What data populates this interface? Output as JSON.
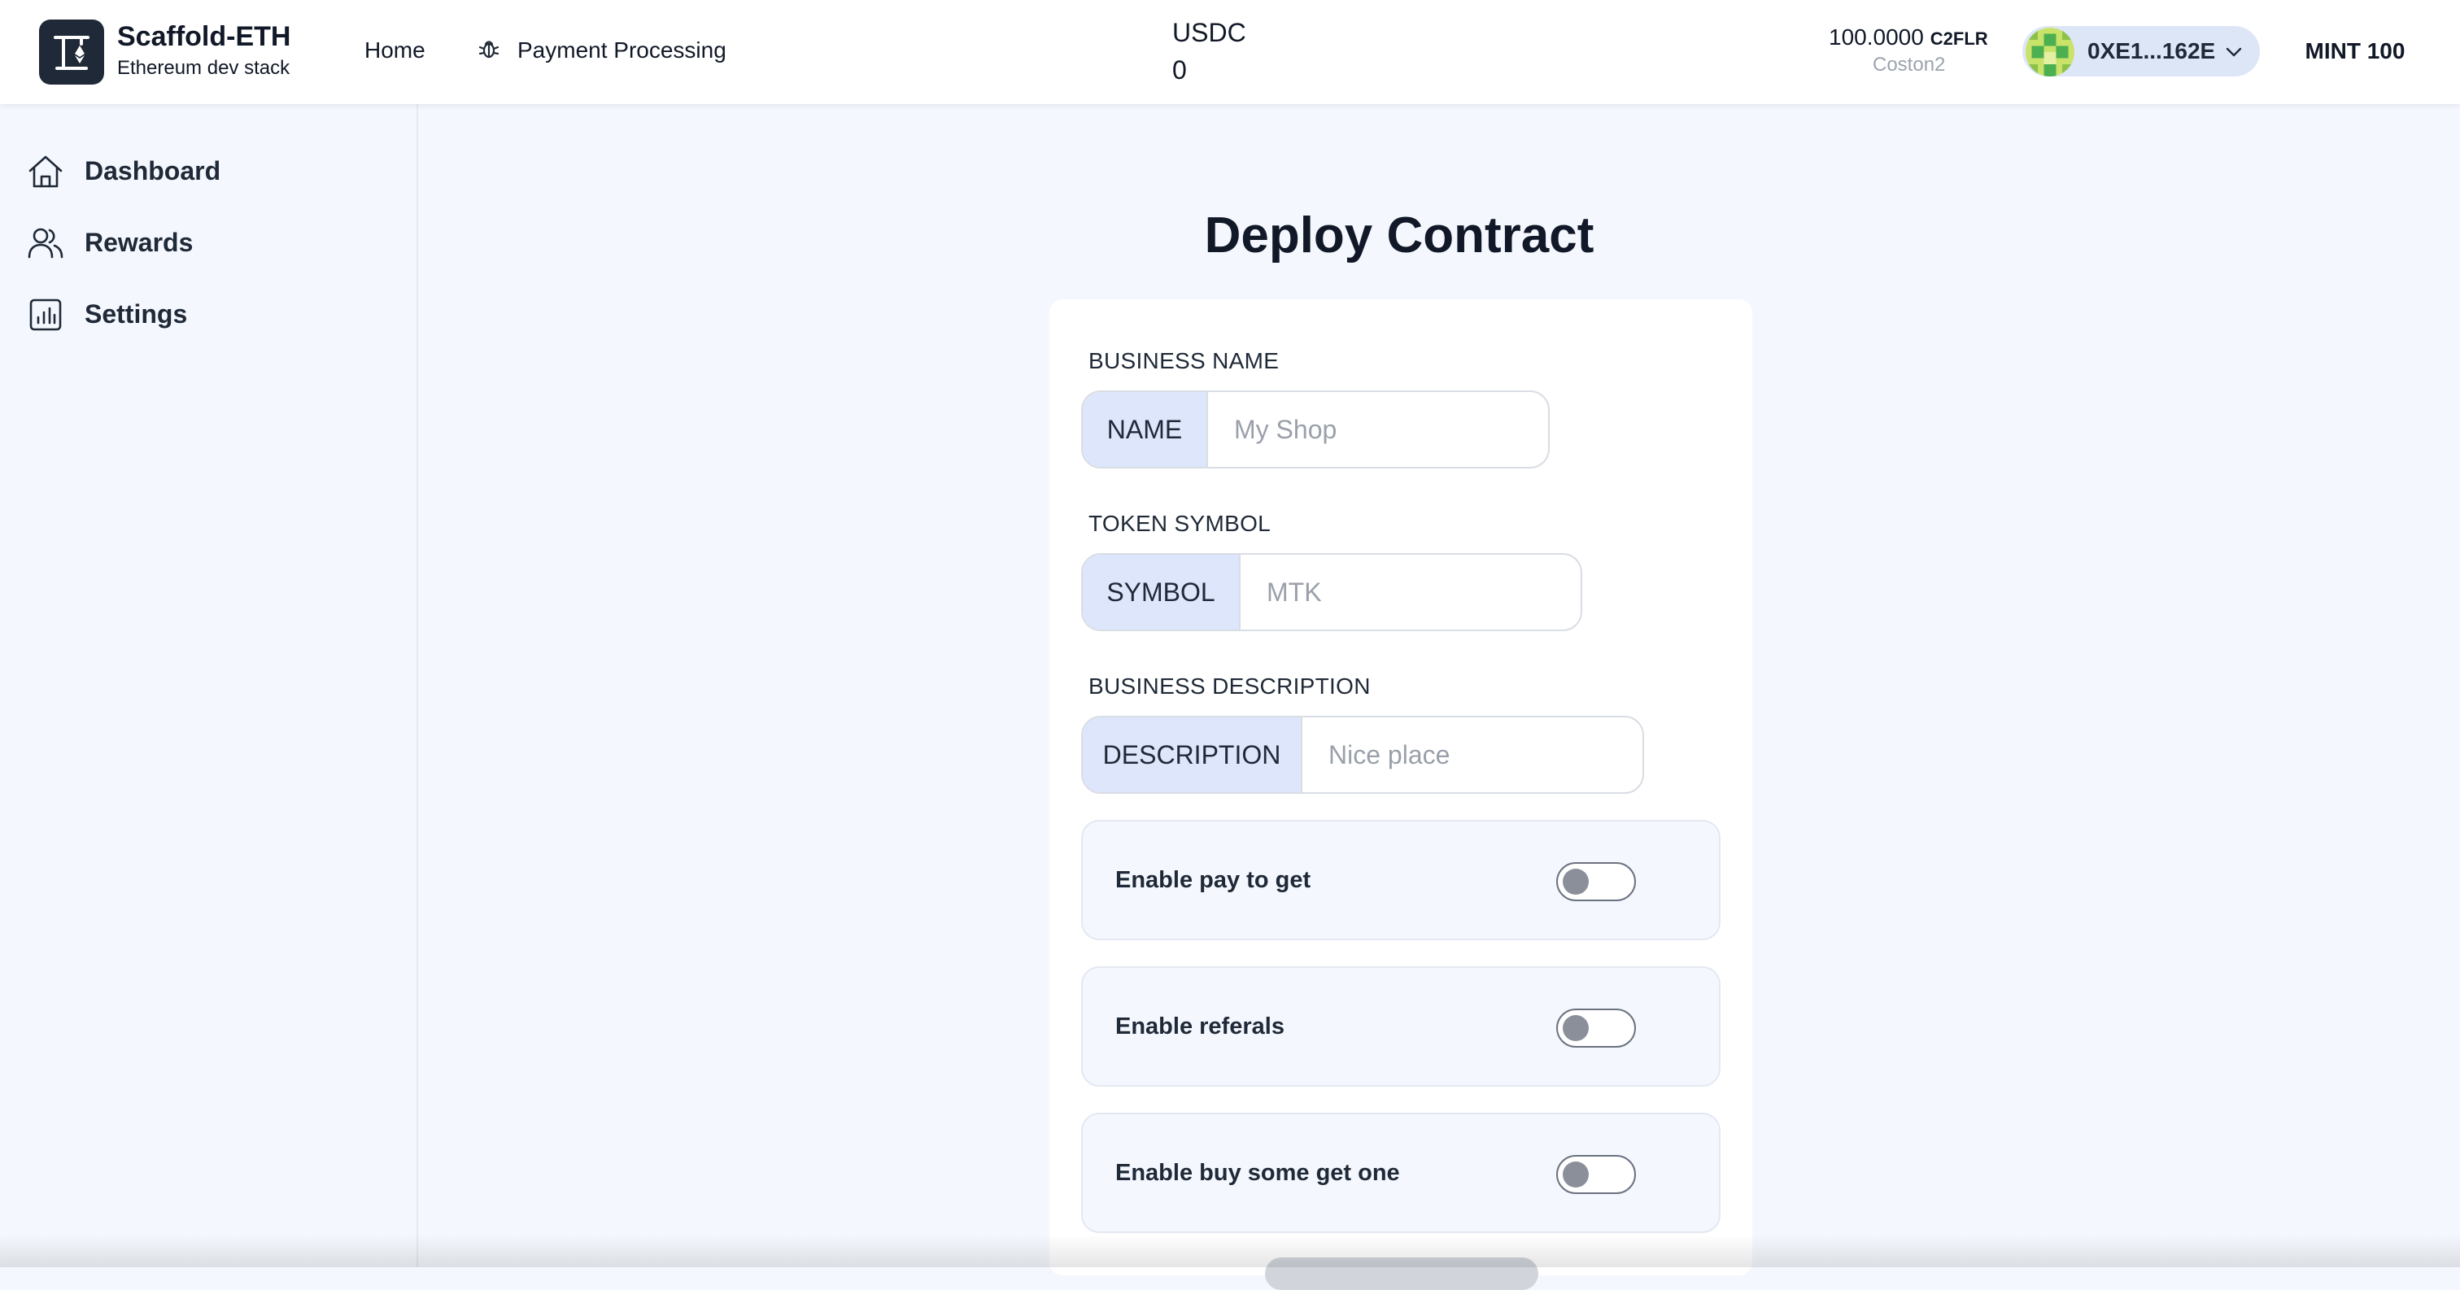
{
  "header": {
    "brand_title": "Scaffold-ETH",
    "brand_subtitle": "Ethereum dev stack",
    "nav": {
      "home": "Home",
      "payment_processing": "Payment Processing"
    },
    "token": {
      "label": "USDC",
      "value": "0"
    },
    "balance": {
      "amount": "100.0000",
      "symbol": "C2FLR",
      "network": "Coston2"
    },
    "account": {
      "address": "0XE1...162E"
    },
    "mint_button": "MINT 100"
  },
  "sidebar": {
    "items": [
      {
        "label": "Dashboard",
        "icon": "home-icon"
      },
      {
        "label": "Rewards",
        "icon": "users-icon"
      },
      {
        "label": "Settings",
        "icon": "chart-icon"
      }
    ]
  },
  "main": {
    "title": "Deploy Contract",
    "fields": {
      "business_name": {
        "label": "BUSINESS NAME",
        "addon": "NAME",
        "placeholder": "My Shop",
        "value": ""
      },
      "token_symbol": {
        "label": "TOKEN SYMBOL",
        "addon": "SYMBOL",
        "placeholder": "MTK",
        "value": ""
      },
      "business_description": {
        "label": "BUSINESS DESCRIPTION",
        "addon": "DESCRIPTION",
        "placeholder": "Nice place",
        "value": ""
      }
    },
    "toggles": [
      {
        "label": "Enable pay to get",
        "checked": false
      },
      {
        "label": "Enable referals",
        "checked": false
      },
      {
        "label": "Enable buy some get one",
        "checked": false
      }
    ]
  },
  "colors": {
    "background": "#f4f7fd",
    "addon_bg": "#dde6fb",
    "account_bg": "#dde6f7",
    "text_primary": "#111827",
    "text_muted": "#9ca3af"
  }
}
